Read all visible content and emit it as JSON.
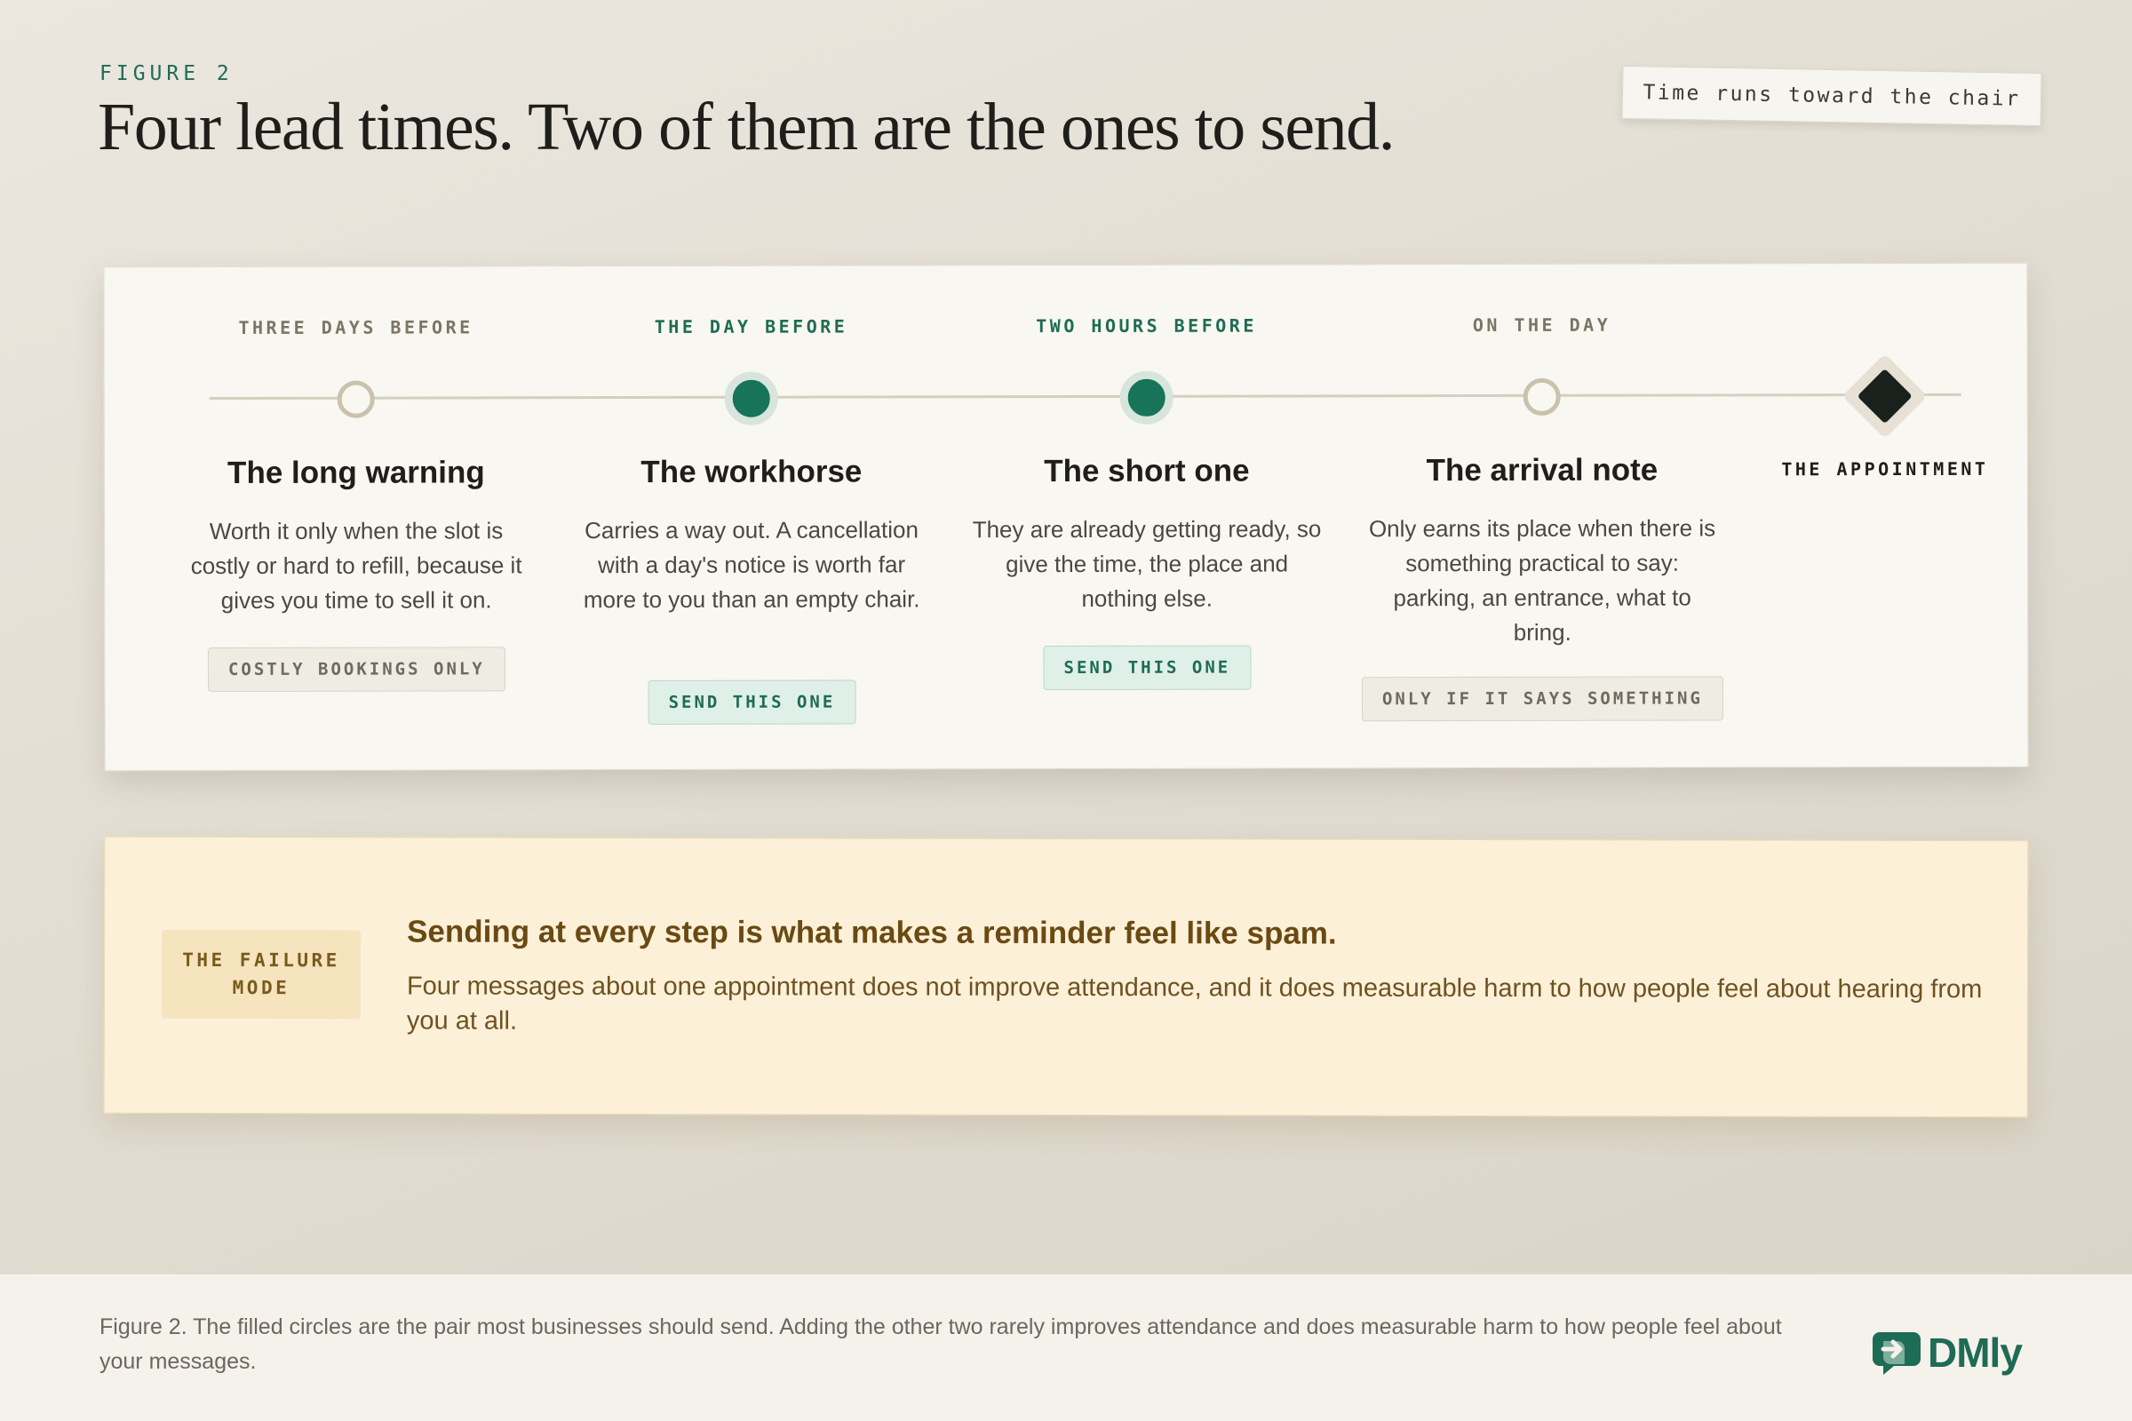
{
  "header": {
    "eyebrow": "FIGURE 2",
    "title": "Four lead times. Two of them are the ones to send.",
    "tag": "Time runs toward the chair"
  },
  "timeline": {
    "stages": [
      {
        "when": "THREE DAYS BEFORE",
        "title": "The long warning",
        "body": "Worth it only when the slot is costly or hard to refill, because it gives you time to sell it on.",
        "badge": "COSTLY BOOKINGS ONLY",
        "recommended": false
      },
      {
        "when": "THE DAY BEFORE",
        "title": "The workhorse",
        "body": "Carries a way out. A cancellation with a day's notice is worth far more to you than an empty chair.",
        "badge": "SEND THIS ONE",
        "recommended": true
      },
      {
        "when": "TWO HOURS BEFORE",
        "title": "The short one",
        "body": "They are already getting ready, so give the time, the place and nothing else.",
        "badge": "SEND THIS ONE",
        "recommended": true
      },
      {
        "when": "ON THE DAY",
        "title": "The arrival note",
        "body": "Only earns its place when there is something practical to say: parking, an entrance, what to bring.",
        "badge": "ONLY IF IT SAYS SOMETHING",
        "recommended": false
      }
    ],
    "endpoint": "THE APPOINTMENT"
  },
  "failure": {
    "label": "THE FAILURE MODE",
    "heading": "Sending at every step is what makes a reminder feel like spam.",
    "body": "Four messages about one appointment does not improve attendance, and it does measurable harm to how people feel about hearing from you at all."
  },
  "footer": {
    "caption": "Figure 2. The filled circles are the pair most businesses should send. Adding the other two rarely improves attendance and does measurable harm to how people feel about your messages.",
    "logo_text": "DMly",
    "logo_icon": "chat-arrow-icon"
  },
  "colors": {
    "accent": "#177458",
    "accent_soft": "#d7e5dc",
    "hollow": "#c9c2ad",
    "failure_bg": "#fcf0d9",
    "failure_text": "#6a4a12"
  }
}
